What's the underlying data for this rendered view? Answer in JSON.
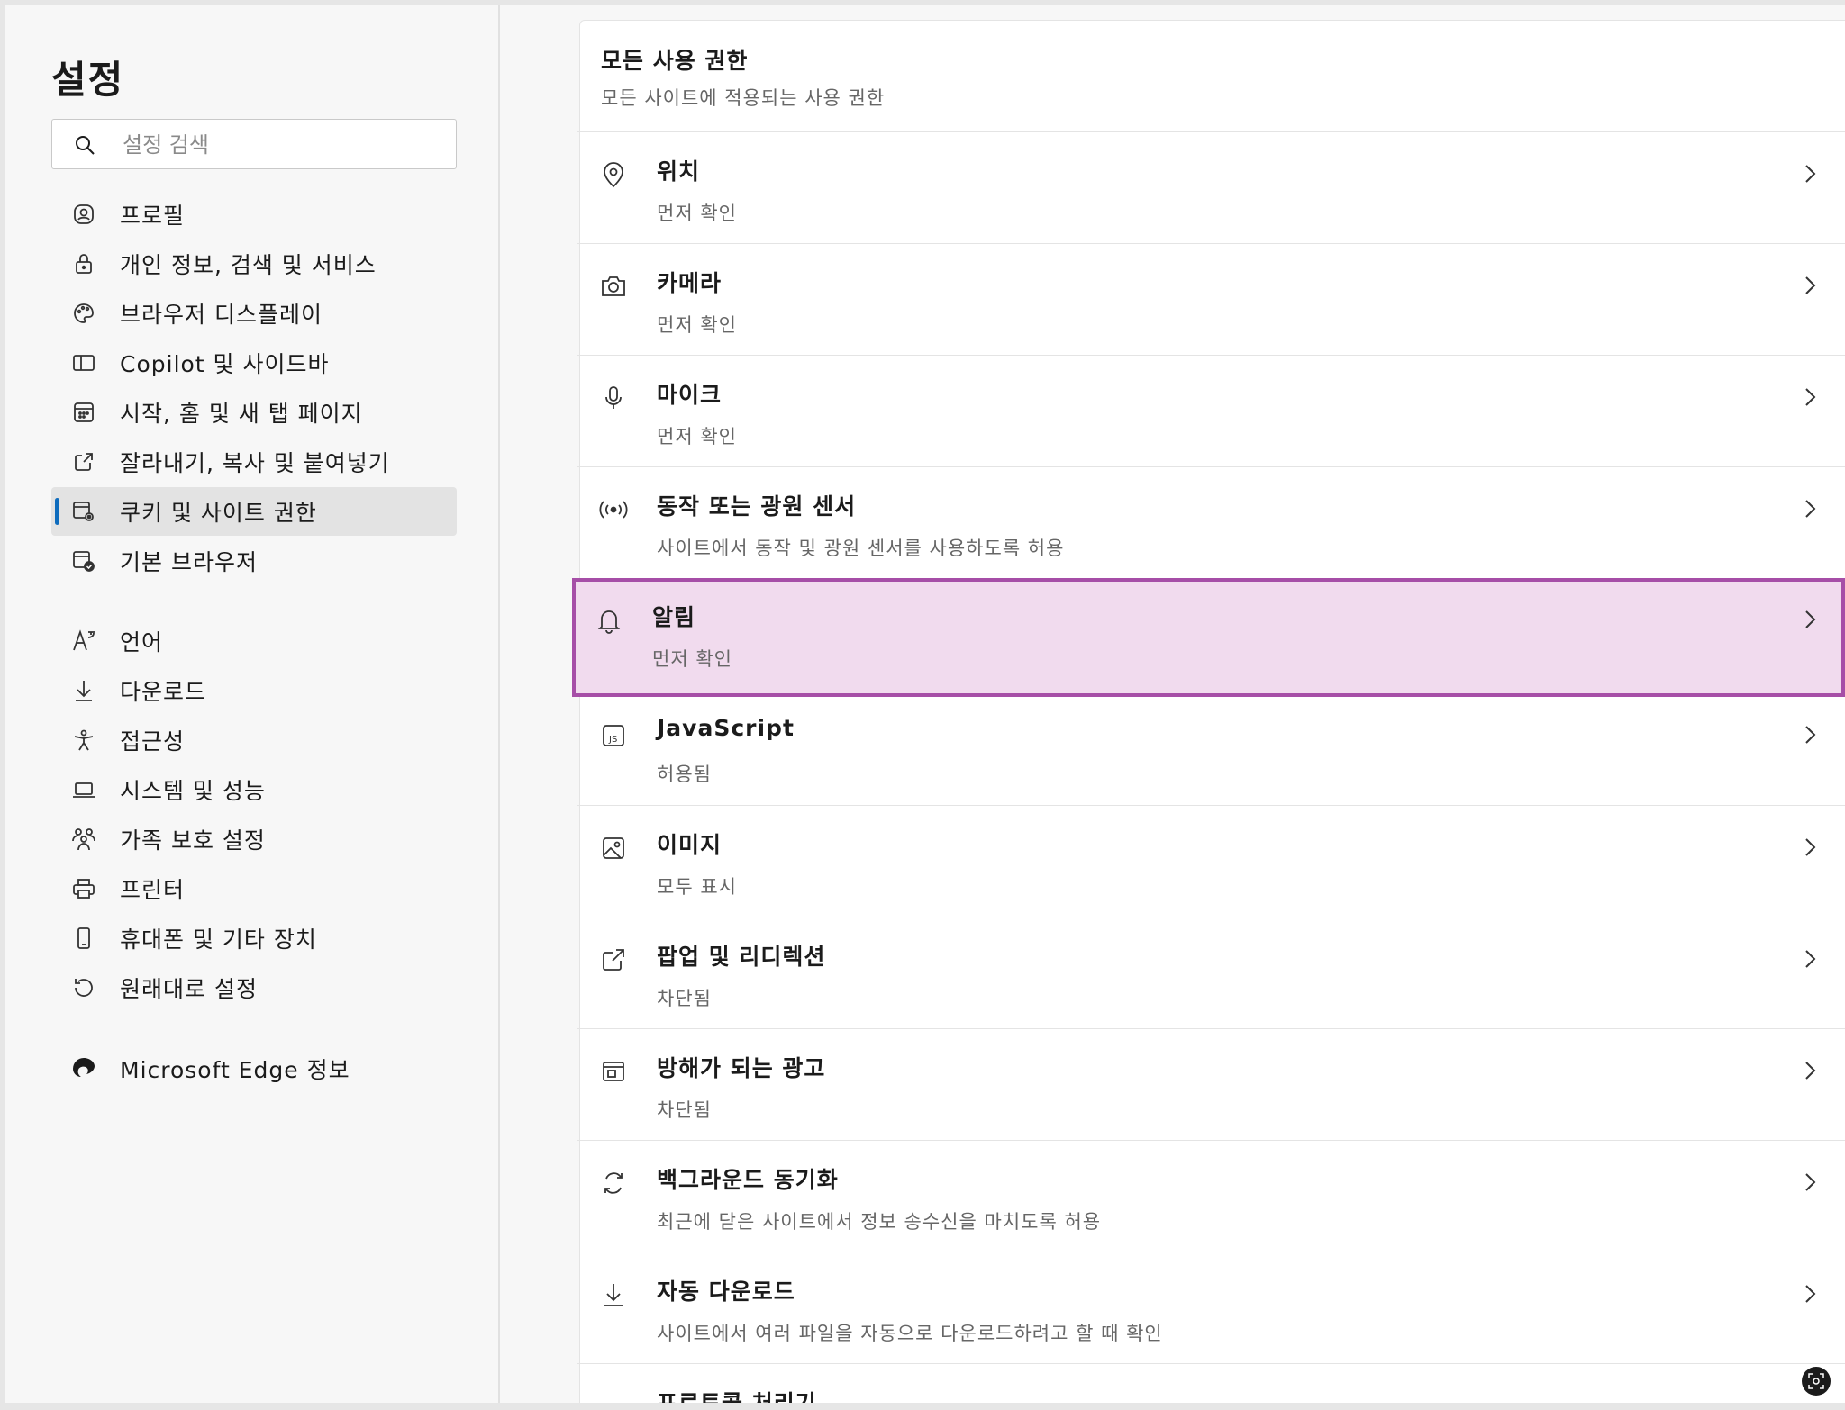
{
  "sidebar": {
    "title": "설정",
    "search_placeholder": "설정 검색",
    "items": [
      {
        "label": "프로필",
        "icon": "profile-icon"
      },
      {
        "label": "개인 정보, 검색 및 서비스",
        "icon": "lock-icon"
      },
      {
        "label": "브라우저 디스플레이",
        "icon": "palette-icon"
      },
      {
        "label": "Copilot 및 사이드바",
        "icon": "sidebar-icon"
      },
      {
        "label": "시작, 홈 및 새 탭 페이지",
        "icon": "home-grid-icon"
      },
      {
        "label": "잘라내기, 복사 및 붙여넣기",
        "icon": "share-icon"
      },
      {
        "label": "쿠키 및 사이트 권한",
        "icon": "cookie-settings-icon",
        "active": true
      },
      {
        "label": "기본 브라우저",
        "icon": "default-browser-icon"
      },
      {
        "label": "언어",
        "icon": "language-icon"
      },
      {
        "label": "다운로드",
        "icon": "download-icon"
      },
      {
        "label": "접근성",
        "icon": "accessibility-icon"
      },
      {
        "label": "시스템 및 성능",
        "icon": "laptop-icon"
      },
      {
        "label": "가족 보호 설정",
        "icon": "family-icon"
      },
      {
        "label": "프린터",
        "icon": "printer-icon"
      },
      {
        "label": "휴대폰 및 기타 장치",
        "icon": "phone-icon"
      },
      {
        "label": "원래대로 설정",
        "icon": "reset-icon"
      },
      {
        "label": "Microsoft Edge 정보",
        "icon": "edge-logo-icon"
      }
    ]
  },
  "main": {
    "section_title": "모든 사용 권한",
    "section_subtitle": "모든 사이트에 적용되는 사용 권한",
    "permissions": [
      {
        "title": "위치",
        "subtitle": "먼저 확인",
        "icon": "location-icon"
      },
      {
        "title": "카메라",
        "subtitle": "먼저 확인",
        "icon": "camera-icon"
      },
      {
        "title": "마이크",
        "subtitle": "먼저 확인",
        "icon": "microphone-icon"
      },
      {
        "title": "동작 또는 광원 센서",
        "subtitle": "사이트에서 동작 및 광원 센서를 사용하도록 허용",
        "icon": "sensor-icon"
      },
      {
        "title": "알림",
        "subtitle": "먼저 확인",
        "icon": "bell-icon",
        "highlighted": true
      },
      {
        "title": "JavaScript",
        "subtitle": "허용됨",
        "icon": "javascript-icon"
      },
      {
        "title": "이미지",
        "subtitle": "모두 표시",
        "icon": "image-icon"
      },
      {
        "title": "팝업 및 리디렉션",
        "subtitle": "차단됨",
        "icon": "popup-icon"
      },
      {
        "title": "방해가 되는 광고",
        "subtitle": "차단됨",
        "icon": "ads-icon"
      },
      {
        "title": "백그라운드 동기화",
        "subtitle": "최근에 닫은 사이트에서 정보 송수신을 마치도록 허용",
        "icon": "sync-icon"
      },
      {
        "title": "자동 다운로드",
        "subtitle": "사이트에서 여러 파일을 자동으로 다운로드하려고 할 때 확인",
        "icon": "download-icon"
      },
      {
        "title": "프로토콜 처리기",
        "subtitle": "",
        "icon": "protocol-icon"
      }
    ]
  },
  "colors": {
    "accent": "#0f6cbd",
    "highlight_fill": "#f1dbee",
    "highlight_border": "#a64ea7"
  }
}
